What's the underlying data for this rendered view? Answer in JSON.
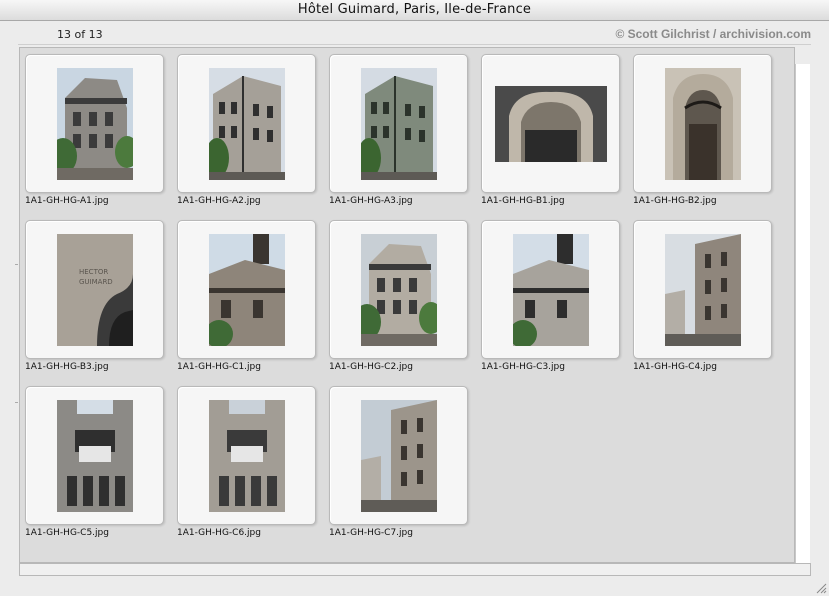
{
  "window": {
    "title": "Hôtel Guimard, Paris, Ile-de-France"
  },
  "header": {
    "counter": "13 of 13",
    "credit": "© Scott Gilchrist / archivision.com"
  },
  "thumbnails": [
    {
      "filename": "1A1-GH-HG-A1.jpg",
      "orientation": "portrait"
    },
    {
      "filename": "1A1-GH-HG-A2.jpg",
      "orientation": "portrait"
    },
    {
      "filename": "1A1-GH-HG-A3.jpg",
      "orientation": "portrait"
    },
    {
      "filename": "1A1-GH-HG-B1.jpg",
      "orientation": "landscape"
    },
    {
      "filename": "1A1-GH-HG-B2.jpg",
      "orientation": "portrait"
    },
    {
      "filename": "1A1-GH-HG-B3.jpg",
      "orientation": "portrait"
    },
    {
      "filename": "1A1-GH-HG-C1.jpg",
      "orientation": "portrait"
    },
    {
      "filename": "1A1-GH-HG-C2.jpg",
      "orientation": "portrait"
    },
    {
      "filename": "1A1-GH-HG-C3.jpg",
      "orientation": "portrait"
    },
    {
      "filename": "1A1-GH-HG-C4.jpg",
      "orientation": "portrait"
    },
    {
      "filename": "1A1-GH-HG-C5.jpg",
      "orientation": "portrait"
    },
    {
      "filename": "1A1-GH-HG-C6.jpg",
      "orientation": "portrait"
    },
    {
      "filename": "1A1-GH-HG-C7.jpg",
      "orientation": "portrait"
    }
  ],
  "colors": {
    "title_bar": "#dcdcdc",
    "grid_background": "#dcdcdc",
    "thumbnail_frame": "#f6f6f6",
    "credit_text": "#8a8a8a"
  }
}
